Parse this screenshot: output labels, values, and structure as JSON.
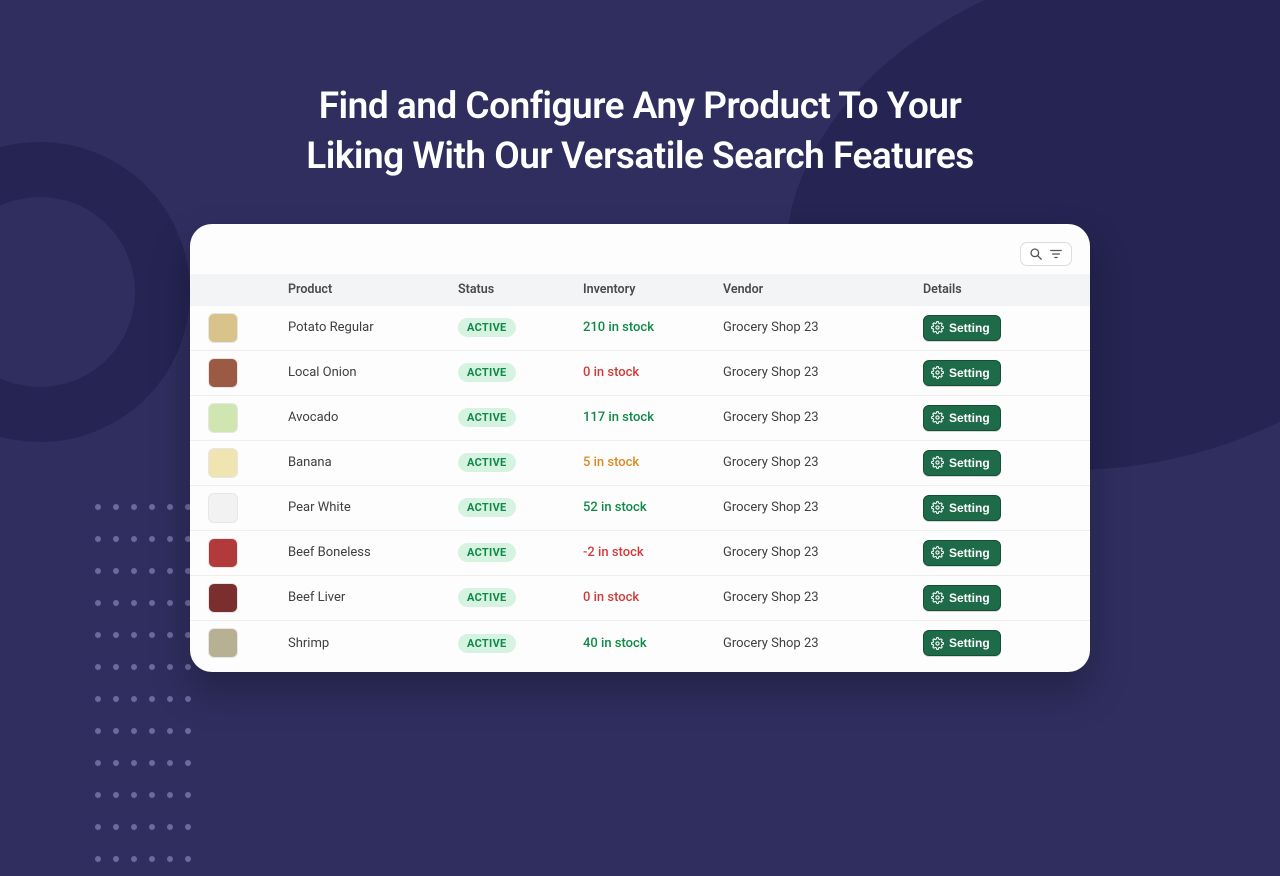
{
  "hero": {
    "line1": "Find and Configure Any Product To Your",
    "line2": "Liking With Our Versatile Search Features"
  },
  "table": {
    "headers": {
      "product": "Product",
      "status": "Status",
      "inventory": "Inventory",
      "vendor": "Vendor",
      "details": "Details"
    },
    "setting_label": "Setting",
    "rows": [
      {
        "name": "Potato Regular",
        "status": "ACTIVE",
        "inventory": "210 in stock",
        "inv_class": "inv-ok",
        "vendor": "Grocery Shop 23",
        "thumb_bg": "#d8c48a"
      },
      {
        "name": "Local Onion",
        "status": "ACTIVE",
        "inventory": "0 in stock",
        "inv_class": "inv-bad",
        "vendor": "Grocery Shop 23",
        "thumb_bg": "#9b5a43"
      },
      {
        "name": "Avocado",
        "status": "ACTIVE",
        "inventory": "117 in stock",
        "inv_class": "inv-ok",
        "vendor": "Grocery Shop 23",
        "thumb_bg": "#cfe6b0"
      },
      {
        "name": "Banana",
        "status": "ACTIVE",
        "inventory": "5 in stock",
        "inv_class": "inv-warn",
        "vendor": "Grocery Shop 23",
        "thumb_bg": "#f0e4b0"
      },
      {
        "name": "Pear White",
        "status": "ACTIVE",
        "inventory": "52 in stock",
        "inv_class": "inv-ok",
        "vendor": "Grocery Shop 23",
        "thumb_bg": "#f2f2f2"
      },
      {
        "name": "Beef Boneless",
        "status": "ACTIVE",
        "inventory": "-2 in stock",
        "inv_class": "inv-bad",
        "vendor": "Grocery Shop 23",
        "thumb_bg": "#b23a3a"
      },
      {
        "name": "Beef Liver",
        "status": "ACTIVE",
        "inventory": "0 in stock",
        "inv_class": "inv-bad",
        "vendor": "Grocery Shop 23",
        "thumb_bg": "#7a2e2e"
      },
      {
        "name": "Shrimp",
        "status": "ACTIVE",
        "inventory": "40 in stock",
        "inv_class": "inv-ok",
        "vendor": "Grocery Shop 23",
        "thumb_bg": "#b7b093"
      }
    ]
  }
}
